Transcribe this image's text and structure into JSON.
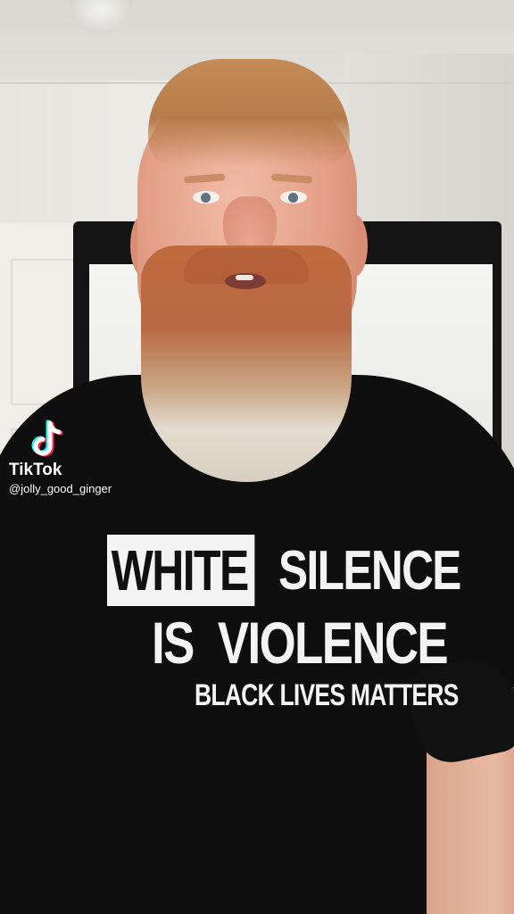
{
  "watermark": {
    "logo_icon": "tiktok-note-icon",
    "brand": "TikTok",
    "handle": "@jolly_good_ginger"
  },
  "shirt_print": {
    "word_highlight": "WHITE",
    "line1_rest": "SILENCE",
    "line2_word1": "IS",
    "line2_word2": "VIOLENCE",
    "line3": "BLACK LIVES MATTERS"
  },
  "colors": {
    "tiktok_cyan": "#25f4ee",
    "tiktok_red": "#fe2c55",
    "shirt": "#0f0f10",
    "print": "#f3f3f3"
  }
}
